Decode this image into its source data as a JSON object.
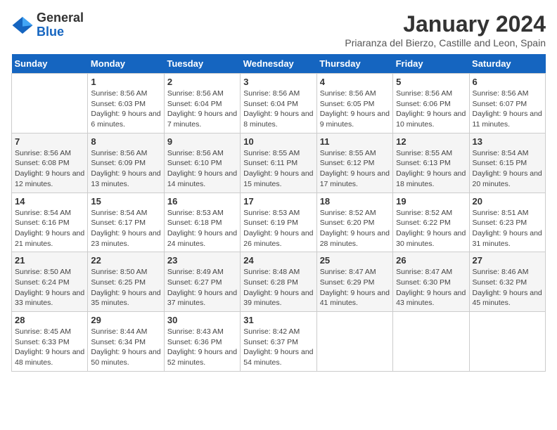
{
  "header": {
    "logo": {
      "general": "General",
      "blue": "Blue"
    },
    "title": "January 2024",
    "subtitle": "Priaranza del Bierzo, Castille and Leon, Spain"
  },
  "calendar": {
    "days_of_week": [
      "Sunday",
      "Monday",
      "Tuesday",
      "Wednesday",
      "Thursday",
      "Friday",
      "Saturday"
    ],
    "weeks": [
      [
        {
          "day": "",
          "info": ""
        },
        {
          "day": "1",
          "info": "Sunrise: 8:56 AM\nSunset: 6:03 PM\nDaylight: 9 hours\nand 6 minutes."
        },
        {
          "day": "2",
          "info": "Sunrise: 8:56 AM\nSunset: 6:04 PM\nDaylight: 9 hours\nand 7 minutes."
        },
        {
          "day": "3",
          "info": "Sunrise: 8:56 AM\nSunset: 6:04 PM\nDaylight: 9 hours\nand 8 minutes."
        },
        {
          "day": "4",
          "info": "Sunrise: 8:56 AM\nSunset: 6:05 PM\nDaylight: 9 hours\nand 9 minutes."
        },
        {
          "day": "5",
          "info": "Sunrise: 8:56 AM\nSunset: 6:06 PM\nDaylight: 9 hours\nand 10 minutes."
        },
        {
          "day": "6",
          "info": "Sunrise: 8:56 AM\nSunset: 6:07 PM\nDaylight: 9 hours\nand 11 minutes."
        }
      ],
      [
        {
          "day": "7",
          "info": "Sunrise: 8:56 AM\nSunset: 6:08 PM\nDaylight: 9 hours\nand 12 minutes."
        },
        {
          "day": "8",
          "info": "Sunrise: 8:56 AM\nSunset: 6:09 PM\nDaylight: 9 hours\nand 13 minutes."
        },
        {
          "day": "9",
          "info": "Sunrise: 8:56 AM\nSunset: 6:10 PM\nDaylight: 9 hours\nand 14 minutes."
        },
        {
          "day": "10",
          "info": "Sunrise: 8:55 AM\nSunset: 6:11 PM\nDaylight: 9 hours\nand 15 minutes."
        },
        {
          "day": "11",
          "info": "Sunrise: 8:55 AM\nSunset: 6:12 PM\nDaylight: 9 hours\nand 17 minutes."
        },
        {
          "day": "12",
          "info": "Sunrise: 8:55 AM\nSunset: 6:13 PM\nDaylight: 9 hours\nand 18 minutes."
        },
        {
          "day": "13",
          "info": "Sunrise: 8:54 AM\nSunset: 6:15 PM\nDaylight: 9 hours\nand 20 minutes."
        }
      ],
      [
        {
          "day": "14",
          "info": "Sunrise: 8:54 AM\nSunset: 6:16 PM\nDaylight: 9 hours\nand 21 minutes."
        },
        {
          "day": "15",
          "info": "Sunrise: 8:54 AM\nSunset: 6:17 PM\nDaylight: 9 hours\nand 23 minutes."
        },
        {
          "day": "16",
          "info": "Sunrise: 8:53 AM\nSunset: 6:18 PM\nDaylight: 9 hours\nand 24 minutes."
        },
        {
          "day": "17",
          "info": "Sunrise: 8:53 AM\nSunset: 6:19 PM\nDaylight: 9 hours\nand 26 minutes."
        },
        {
          "day": "18",
          "info": "Sunrise: 8:52 AM\nSunset: 6:20 PM\nDaylight: 9 hours\nand 28 minutes."
        },
        {
          "day": "19",
          "info": "Sunrise: 8:52 AM\nSunset: 6:22 PM\nDaylight: 9 hours\nand 30 minutes."
        },
        {
          "day": "20",
          "info": "Sunrise: 8:51 AM\nSunset: 6:23 PM\nDaylight: 9 hours\nand 31 minutes."
        }
      ],
      [
        {
          "day": "21",
          "info": "Sunrise: 8:50 AM\nSunset: 6:24 PM\nDaylight: 9 hours\nand 33 minutes."
        },
        {
          "day": "22",
          "info": "Sunrise: 8:50 AM\nSunset: 6:25 PM\nDaylight: 9 hours\nand 35 minutes."
        },
        {
          "day": "23",
          "info": "Sunrise: 8:49 AM\nSunset: 6:27 PM\nDaylight: 9 hours\nand 37 minutes."
        },
        {
          "day": "24",
          "info": "Sunrise: 8:48 AM\nSunset: 6:28 PM\nDaylight: 9 hours\nand 39 minutes."
        },
        {
          "day": "25",
          "info": "Sunrise: 8:47 AM\nSunset: 6:29 PM\nDaylight: 9 hours\nand 41 minutes."
        },
        {
          "day": "26",
          "info": "Sunrise: 8:47 AM\nSunset: 6:30 PM\nDaylight: 9 hours\nand 43 minutes."
        },
        {
          "day": "27",
          "info": "Sunrise: 8:46 AM\nSunset: 6:32 PM\nDaylight: 9 hours\nand 45 minutes."
        }
      ],
      [
        {
          "day": "28",
          "info": "Sunrise: 8:45 AM\nSunset: 6:33 PM\nDaylight: 9 hours\nand 48 minutes."
        },
        {
          "day": "29",
          "info": "Sunrise: 8:44 AM\nSunset: 6:34 PM\nDaylight: 9 hours\nand 50 minutes."
        },
        {
          "day": "30",
          "info": "Sunrise: 8:43 AM\nSunset: 6:36 PM\nDaylight: 9 hours\nand 52 minutes."
        },
        {
          "day": "31",
          "info": "Sunrise: 8:42 AM\nSunset: 6:37 PM\nDaylight: 9 hours\nand 54 minutes."
        },
        {
          "day": "",
          "info": ""
        },
        {
          "day": "",
          "info": ""
        },
        {
          "day": "",
          "info": ""
        }
      ]
    ]
  }
}
